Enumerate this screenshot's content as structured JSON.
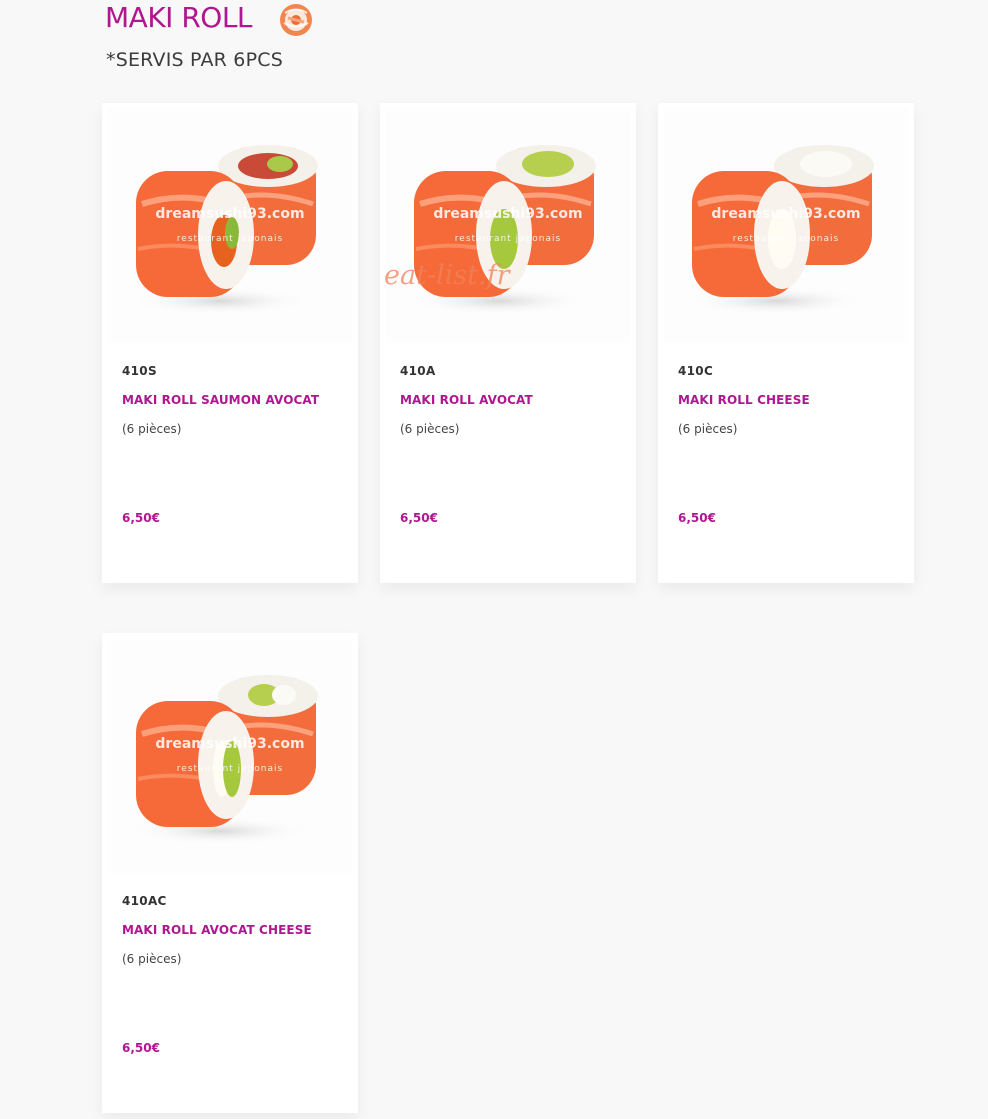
{
  "section": {
    "title": "MAKI ROLL",
    "subtitle": "*SERVIS PAR 6PCS",
    "icon": "maki-roll-icon"
  },
  "watermark": "eat-list.fr",
  "image_text": {
    "site": "dreamsushi93.com",
    "tagline": "restaurant japonais"
  },
  "colors": {
    "accent": "#b0168f",
    "background": "#f8f8f8",
    "card": "#ffffff",
    "salmon": "#f36d3c"
  },
  "products": [
    {
      "code": "410S",
      "name": "MAKI ROLL SAUMON AVOCAT",
      "description": "(6 pièces)",
      "price": "6,50€",
      "filling": "salmon-avocado"
    },
    {
      "code": "410A",
      "name": "MAKI ROLL AVOCAT",
      "description": "(6 pièces)",
      "price": "6,50€",
      "filling": "avocado"
    },
    {
      "code": "410C",
      "name": "MAKI ROLL CHEESE",
      "description": "(6 pièces)",
      "price": "6,50€",
      "filling": "cheese"
    },
    {
      "code": "410AC",
      "name": "MAKI ROLL AVOCAT CHEESE",
      "description": "(6 pièces)",
      "price": "6,50€",
      "filling": "avocado-cheese"
    }
  ]
}
